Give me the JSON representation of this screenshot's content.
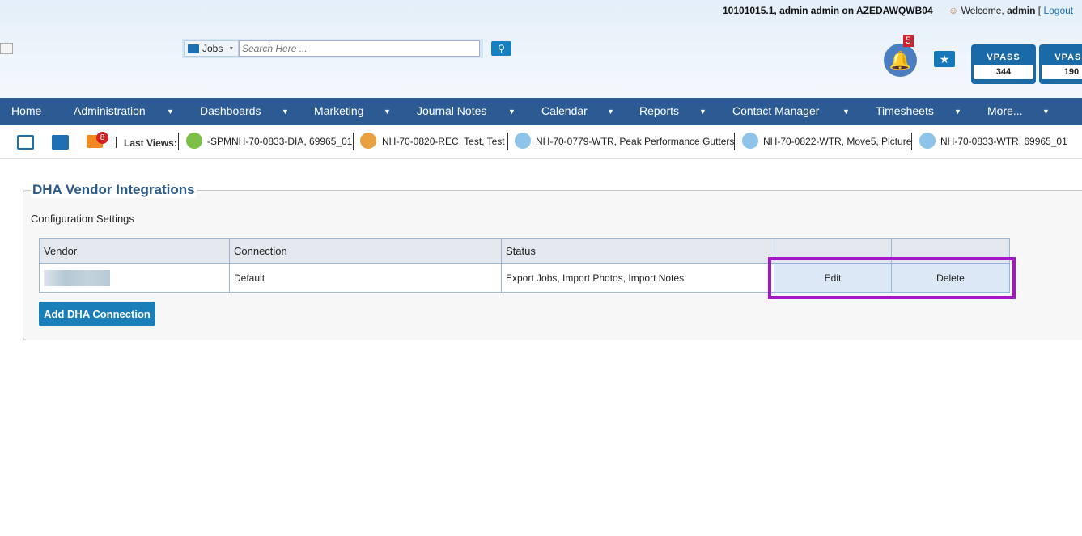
{
  "header": {
    "system_line": "10101015.1, admin admin on AZEDAWQWB04",
    "welcome_prefix": "Welcome, ",
    "user": "admin",
    "bracket": " [ ",
    "logout": "Logout",
    "search": {
      "category": "Jobs",
      "placeholder": "Search Here ..."
    },
    "notifications_count": "5",
    "vpass": [
      {
        "label": "VPASS",
        "value": "344"
      },
      {
        "label": "VPASS",
        "value": "190"
      }
    ]
  },
  "nav": [
    "Home",
    "Administration",
    "Dashboards",
    "Marketing",
    "Journal Notes",
    "Calendar",
    "Reports",
    "Contact Manager",
    "Timesheets",
    "More..."
  ],
  "toolbar": {
    "badge": "8",
    "last_views_label": "Last Views:",
    "recent": [
      "-SPMNH-70-0833-DIA, 69965_01",
      "NH-70-0820-REC, Test, Test",
      "NH-70-0779-WTR, Peak Performance Gutters",
      "NH-70-0822-WTR, Move5, Picture",
      "NH-70-0833-WTR, 69965_01"
    ]
  },
  "main": {
    "title": "DHA Vendor Integrations",
    "subtitle": "Configuration Settings",
    "columns": [
      "Vendor",
      "Connection",
      "Status",
      "",
      ""
    ],
    "rows": [
      {
        "vendor": "",
        "connection": "Default",
        "status": "Export Jobs, Import Photos, Import Notes",
        "edit": "Edit",
        "delete": "Delete"
      }
    ],
    "add_button": "Add DHA Connection"
  },
  "colors": {
    "nav": "#2c5b94",
    "accent": "#1a7fb8",
    "highlight": "#a516c5",
    "title": "#2c5a8a"
  }
}
